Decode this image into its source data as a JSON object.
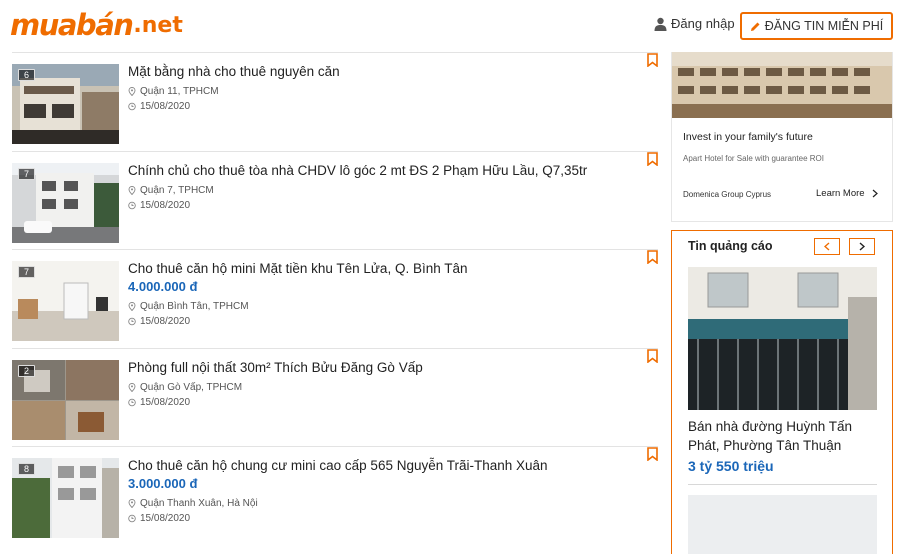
{
  "header": {
    "logo_main": "muabán",
    "logo_tld": ".net",
    "login_label": "Đăng nhập",
    "post_button_label": "ĐĂNG TIN MIỄN PHÍ"
  },
  "listings": [
    {
      "title": "Mặt bằng nhà cho thuê nguyên căn",
      "price": "",
      "location": "Quận 11, TPHCM",
      "date": "15/08/2020",
      "photo_count": "6"
    },
    {
      "title": "Chính chủ cho thuê tòa nhà CHDV lô góc 2 mt ĐS 2 Phạm Hữu Lầu, Q7,35tr",
      "price": "",
      "location": "Quận 7, TPHCM",
      "date": "15/08/2020",
      "photo_count": "7"
    },
    {
      "title": "Cho thuê căn hộ mini Mặt tiền khu Tên Lửa, Q. Bình Tân",
      "price": "4.000.000 đ",
      "location": "Quận Bình Tân, TPHCM",
      "date": "15/08/2020",
      "photo_count": "7"
    },
    {
      "title": "Phòng full nội thất 30m² Thích Bửu Đăng Gò Vấp",
      "price": "",
      "location": "Quận Gò Vấp, TPHCM",
      "date": "15/08/2020",
      "photo_count": "2"
    },
    {
      "title": "Cho thuê căn hộ chung cư mini cao cấp 565 Nguyễn Trãi-Thanh Xuân",
      "price": "3.000.000 đ",
      "location": "Quận Thanh Xuân, Hà Nội",
      "date": "15/08/2020",
      "photo_count": "8"
    }
  ],
  "ad": {
    "headline": "Invest in your family's future",
    "subline": "Apart Hotel for Sale with guarantee ROI",
    "brand": "Domenica Group Cyprus",
    "cta": "Learn More"
  },
  "promo": {
    "heading": "Tin quảng cáo",
    "title": "Bán nhà đường Huỳnh Tấn Phát, Phường Tân Thuận",
    "price": "3 tỷ 550 triệu"
  },
  "colors": {
    "brand": "#ef6c00",
    "price": "#1a66b8"
  },
  "icons": [
    "user-icon",
    "pencil-icon",
    "location-pin-icon",
    "clock-icon",
    "bookmark-icon",
    "chevron-left-icon",
    "chevron-right-icon"
  ]
}
